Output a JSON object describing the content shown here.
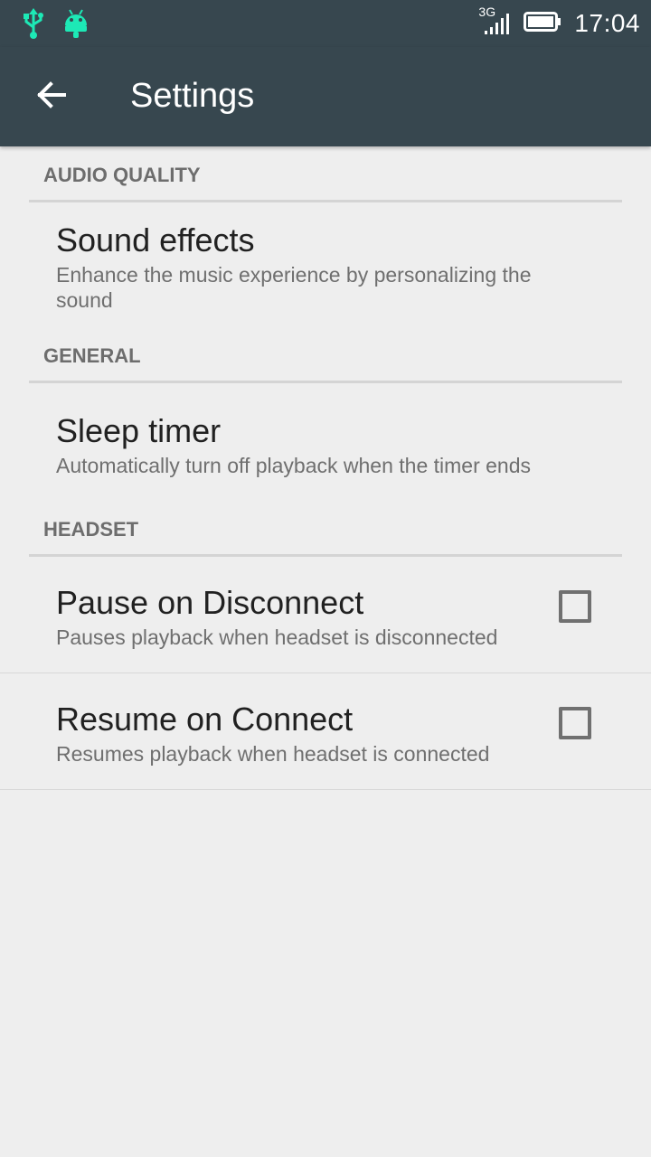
{
  "status_bar": {
    "network": "3G",
    "time": "17:04",
    "icons": [
      "usb-icon",
      "android-icon",
      "signal-icon",
      "battery-icon"
    ],
    "accent_color": "#1de9b6"
  },
  "app_bar": {
    "title": "Settings",
    "back_icon": "arrow-back-icon",
    "background": "#37474f"
  },
  "sections": [
    {
      "header": "AUDIO QUALITY",
      "items": [
        {
          "title": "Sound effects",
          "summary": "Enhance the music experience by personalizing the sound"
        }
      ]
    },
    {
      "header": "GENERAL",
      "items": [
        {
          "title": "Sleep timer",
          "summary": "Automatically turn off playback when the timer ends"
        }
      ]
    },
    {
      "header": "HEADSET",
      "items": [
        {
          "title": "Pause on Disconnect",
          "summary": "Pauses playback when headset is disconnected",
          "checked": false
        },
        {
          "title": "Resume on Connect",
          "summary": "Resumes playback when headset is connected",
          "checked": false
        }
      ]
    }
  ]
}
